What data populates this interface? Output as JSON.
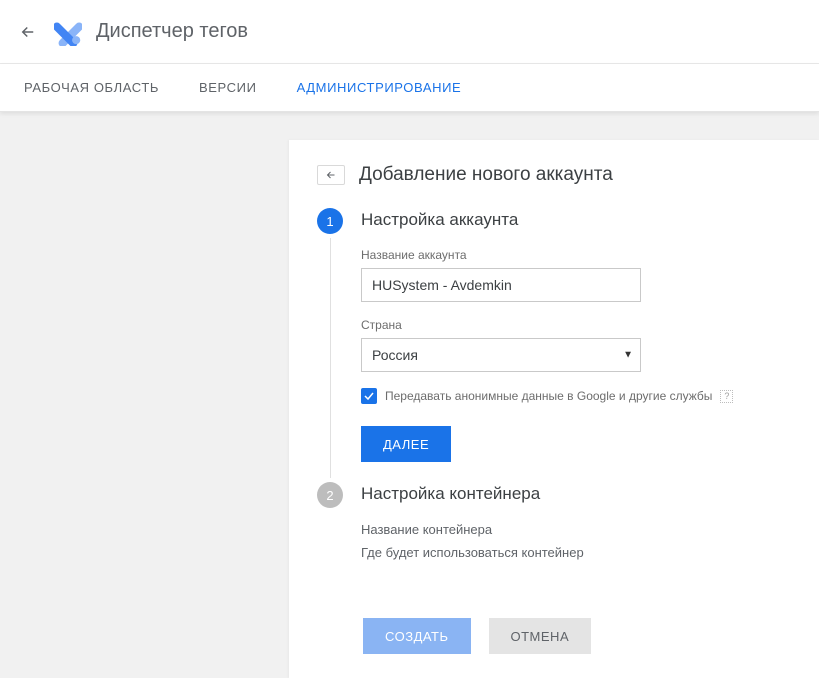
{
  "header": {
    "app_title": "Диспетчер тегов"
  },
  "tabs": {
    "workspace": "РАБОЧАЯ ОБЛАСТЬ",
    "versions": "ВЕРСИИ",
    "admin": "АДМИНИСТРИРОВАНИЕ"
  },
  "card": {
    "title": "Добавление нового аккаунта",
    "step1": {
      "number": "1",
      "title": "Настройка аккаунта",
      "account_name_label": "Название аккаунта",
      "account_name_value": "HUSystem - Avdemkin",
      "country_label": "Страна",
      "country_value": "Россия",
      "share_checkbox_label": "Передавать анонимные данные в Google и другие службы",
      "help_mark": "?",
      "next_button": "ДАЛЕЕ"
    },
    "step2": {
      "number": "2",
      "title": "Настройка контейнера",
      "line1": "Название контейнера",
      "line2": "Где будет использоваться контейнер"
    },
    "footer": {
      "create": "СОЗДАТЬ",
      "cancel": "ОТМЕНА"
    }
  }
}
